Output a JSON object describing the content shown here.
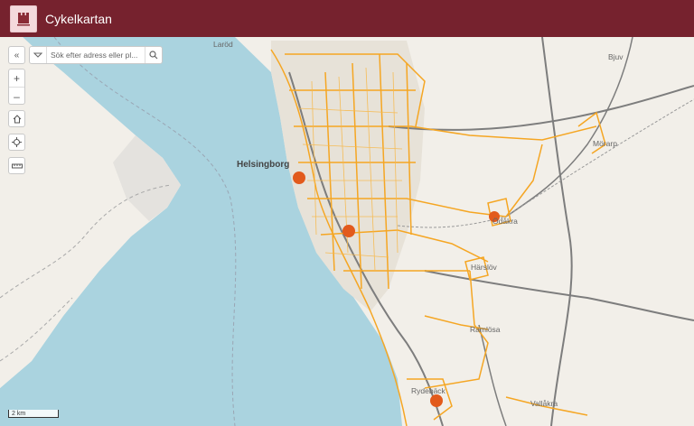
{
  "header": {
    "title": "Cykelkartan",
    "logo_icon": "city-crest-icon",
    "background": "#76222e"
  },
  "controls": {
    "collapse_icon": "double-chevron-left-icon",
    "zoom_in": "+",
    "zoom_out": "–",
    "home_icon": "home-icon",
    "locate_icon": "crosshair-icon",
    "measure_icon": "ruler-icon"
  },
  "search": {
    "placeholder": "Sök efter adress eller pl...",
    "dropdown_icon": "chevron-down-icon",
    "button_icon": "search-icon"
  },
  "map": {
    "labels": {
      "city": "Helsingborg",
      "larod": "Laröd",
      "bjuv": "Bjuv",
      "morarp": "Mörarp",
      "odakra": "Ödåkra",
      "harslov": "Härslöv",
      "ramlosa": "Ramlösa",
      "vallakra": "Vallåkra",
      "rydeback": "Rydebäck"
    },
    "colors": {
      "water": "#aad3df",
      "land": "#f2efe9",
      "bike_route": "#f5a623",
      "marker": "#e25a1c"
    },
    "scale": "2 km",
    "marker_count": 4
  }
}
